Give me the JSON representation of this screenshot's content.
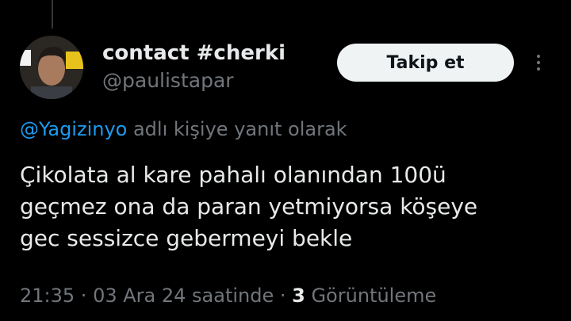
{
  "colors": {
    "background": "#000000",
    "primary_text": "#e7e9ea",
    "secondary_text": "#71767b",
    "mention": "#1d9bf0",
    "follow_button_bg": "#eff3f4",
    "follow_button_text": "#0f1419"
  },
  "author": {
    "display_name": "contact #cherki",
    "handle": "@paulistapar",
    "avatar_icon": "profile-photo"
  },
  "actions": {
    "follow_label": "Takip et",
    "more_icon": "vertical-ellipsis-icon"
  },
  "reply_context": {
    "mention": "@Yagizinyo",
    "suffix": " adlı kişiye yanıt olarak"
  },
  "tweet": {
    "lines": [
      "Çikolata al kare pahalı olanından 100ü",
      "geçmez ona da paran yetmiyorsa köşeye",
      "gec sessizce gebermeyi bekle"
    ]
  },
  "meta": {
    "time": "21:35",
    "separator": " · ",
    "date": "03 Ara 24 saatinde",
    "views_count": "3",
    "views_label": " Görüntüleme"
  }
}
